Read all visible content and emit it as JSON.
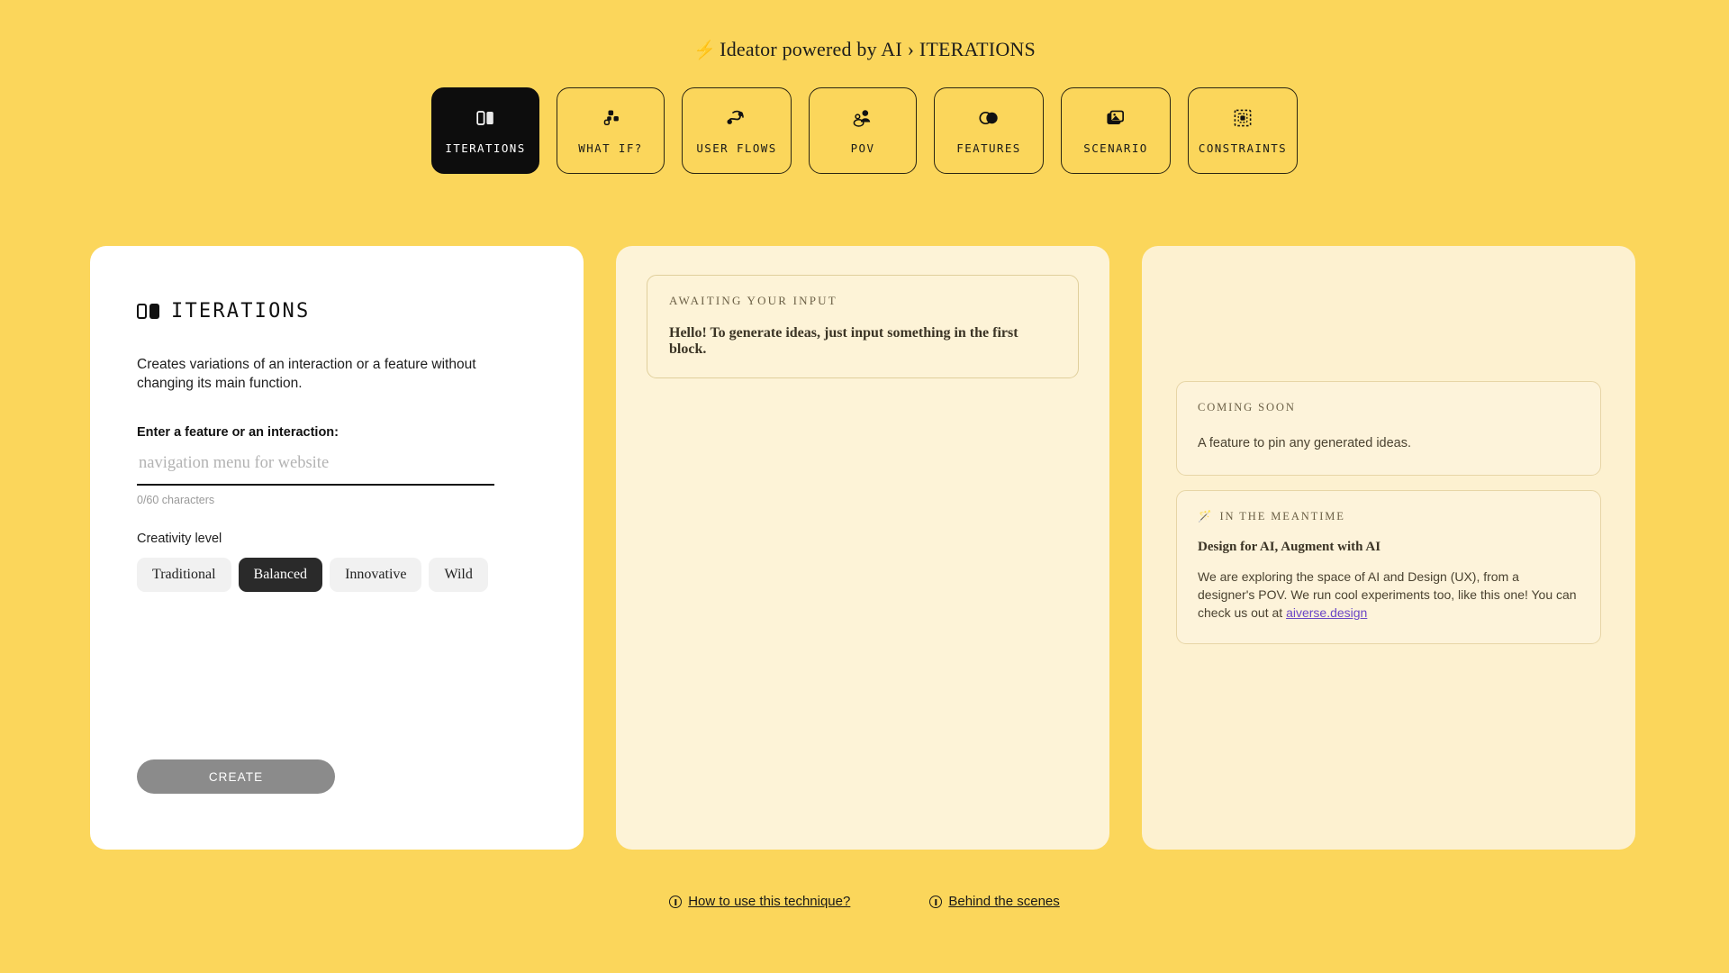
{
  "header": {
    "bolt_icon": "lightning-bolt-icon",
    "title": "Ideator powered by AI › ITERATIONS"
  },
  "tabs": [
    {
      "label": "ITERATIONS",
      "icon": "two-panels-icon",
      "active": true
    },
    {
      "label": "WHAT IF?",
      "icon": "scatter-blocks-icon",
      "active": false
    },
    {
      "label": "USER FLOWS",
      "icon": "flow-nodes-icon",
      "active": false
    },
    {
      "label": "POV",
      "icon": "two-persons-icon",
      "active": false
    },
    {
      "label": "FEATURES",
      "icon": "venn-circles-icon",
      "active": false
    },
    {
      "label": "SCENARIO",
      "icon": "photos-stack-icon",
      "active": false
    },
    {
      "label": "CONSTRAINTS",
      "icon": "dashed-frame-icon",
      "active": false
    }
  ],
  "left_panel": {
    "title": "ITERATIONS",
    "title_icon": "two-panels-icon",
    "description": "Creates variations of an interaction or a feature without changing its main function.",
    "field_label": "Enter a feature or an interaction:",
    "input_value": "",
    "input_placeholder": "navigation menu for website",
    "counter": "0/60 characters",
    "creativity_label": "Creativity level",
    "creativity_options": [
      {
        "label": "Traditional",
        "selected": false
      },
      {
        "label": "Balanced",
        "selected": true
      },
      {
        "label": "Innovative",
        "selected": false
      },
      {
        "label": "Wild",
        "selected": false
      }
    ],
    "create_button": "CREATE"
  },
  "middle_panel": {
    "status_label": "AWAITING YOUR INPUT",
    "status_text": "Hello! To generate ideas, just input something in the first block."
  },
  "right_panel": {
    "coming_soon": {
      "label": "COMING SOON",
      "body": "A feature to pin any generated ideas."
    },
    "meantime": {
      "icon": "magic-wand-icon",
      "label": "IN THE MEANTIME",
      "heading": "Design for AI, Augment with AI",
      "paragraph_before_link": "We are exploring the space of AI and Design (UX), from a designer's POV. We run cool experiments too, like this one! You can check us out at ",
      "link_text": "aiverse.design"
    }
  },
  "footer": {
    "links": [
      {
        "label": "How to use this technique?",
        "icon": "info-icon"
      },
      {
        "label": "Behind the scenes",
        "icon": "info-icon"
      }
    ]
  },
  "colors": {
    "background": "#FBD65B",
    "panel_white": "#FFFFFF",
    "panel_cream": "#FDF3D7",
    "active_tab": "#0D0D0D",
    "link_purple": "#6B47C6",
    "create_disabled": "#8B8B8B"
  }
}
